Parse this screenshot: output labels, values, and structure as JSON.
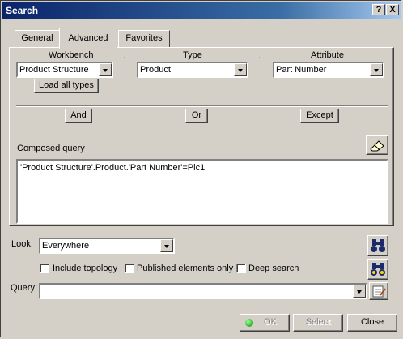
{
  "window": {
    "title": "Search",
    "help_btn": "?",
    "close_btn": "X"
  },
  "tabs": [
    {
      "label": "General",
      "active": false
    },
    {
      "label": "Advanced",
      "active": true
    },
    {
      "label": "Favorites",
      "active": false
    }
  ],
  "filters": {
    "workbench_label": "Workbench",
    "workbench_value": "Product Structure",
    "type_label": "Type",
    "type_value": "Product",
    "attribute_label": "Attribute",
    "attribute_value": "Part Number",
    "dot1": ".",
    "dot2": ".",
    "load_all_types": "Load all types"
  },
  "operators": {
    "and": "And",
    "or": "Or",
    "except": "Except"
  },
  "composed": {
    "label": "Composed query",
    "text": "'Product Structure'.Product.'Part Number'=Pic1"
  },
  "look": {
    "label": "Look:",
    "value": "Everywhere"
  },
  "options": {
    "include_topology": "Include topology",
    "published_only": "Published elements only",
    "deep_search": "Deep search"
  },
  "query": {
    "label": "Query:",
    "value": ""
  },
  "footer": {
    "ok": "OK",
    "select": "Select",
    "close": "Close"
  },
  "colors": {
    "title_start": "#0a246a",
    "title_end": "#a6caf0",
    "face": "#d4d0c8"
  }
}
